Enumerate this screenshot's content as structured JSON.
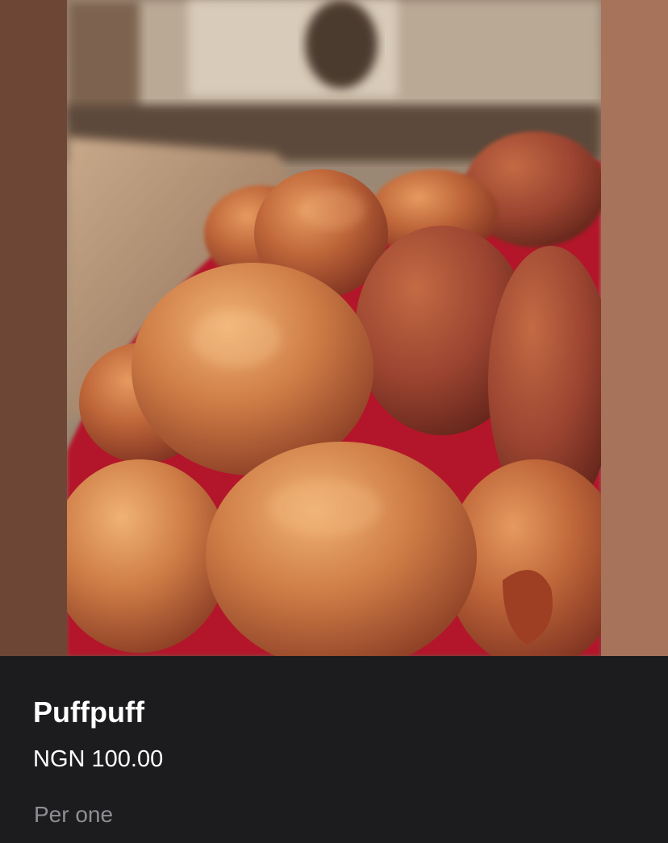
{
  "product": {
    "name": "Puffpuff",
    "price": "NGN 100.00",
    "unit_note": "Per one"
  },
  "photo": {
    "icon": "product-photo",
    "background_left": "#6e4636",
    "background_right": "#a8735b"
  },
  "colors": {
    "panel_background": "#1c1c1e",
    "title_text": "#ffffff",
    "secondary_text": "#8e8e93"
  }
}
